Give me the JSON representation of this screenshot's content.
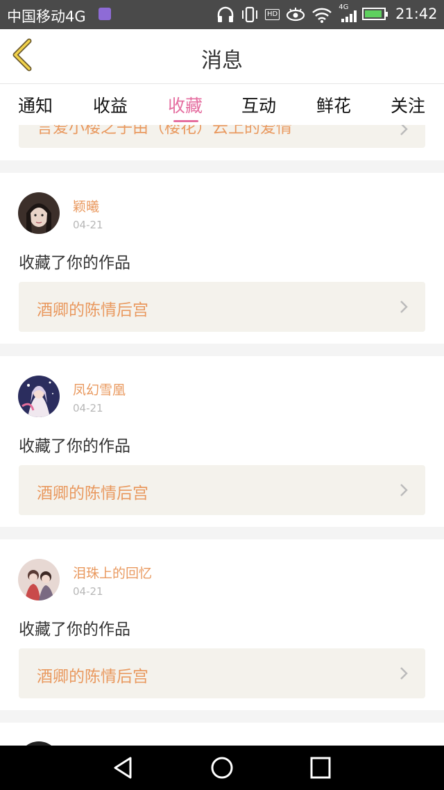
{
  "status_bar": {
    "carrier": "中国移动4G",
    "network_label": "4G",
    "hd_label": "HD",
    "time": "21:42"
  },
  "header": {
    "title": "消息"
  },
  "tabs": [
    {
      "label": "通知"
    },
    {
      "label": "收益"
    },
    {
      "label": "收藏",
      "active": true
    },
    {
      "label": "互动"
    },
    {
      "label": "鲜花"
    },
    {
      "label": "关注"
    }
  ],
  "feed": {
    "partial_top_item_title": "言爱小楼之子由（楼花）云上的爱情",
    "items": [
      {
        "username": "颖曦",
        "date": "04-21",
        "action": "收藏了你的作品",
        "work_title": "酒卿的陈情后宫"
      },
      {
        "username": "凤幻雪凰",
        "date": "04-21",
        "action": "收藏了你的作品",
        "work_title": "酒卿的陈情后宫"
      },
      {
        "username": "泪珠上的回忆",
        "date": "04-21",
        "action": "收藏了你的作品",
        "work_title": "酒卿的陈情后宫"
      }
    ]
  },
  "colors": {
    "accent_pink": "#e56ea0",
    "username_orange": "#e9995f",
    "link_bg": "#f4f2ec"
  }
}
